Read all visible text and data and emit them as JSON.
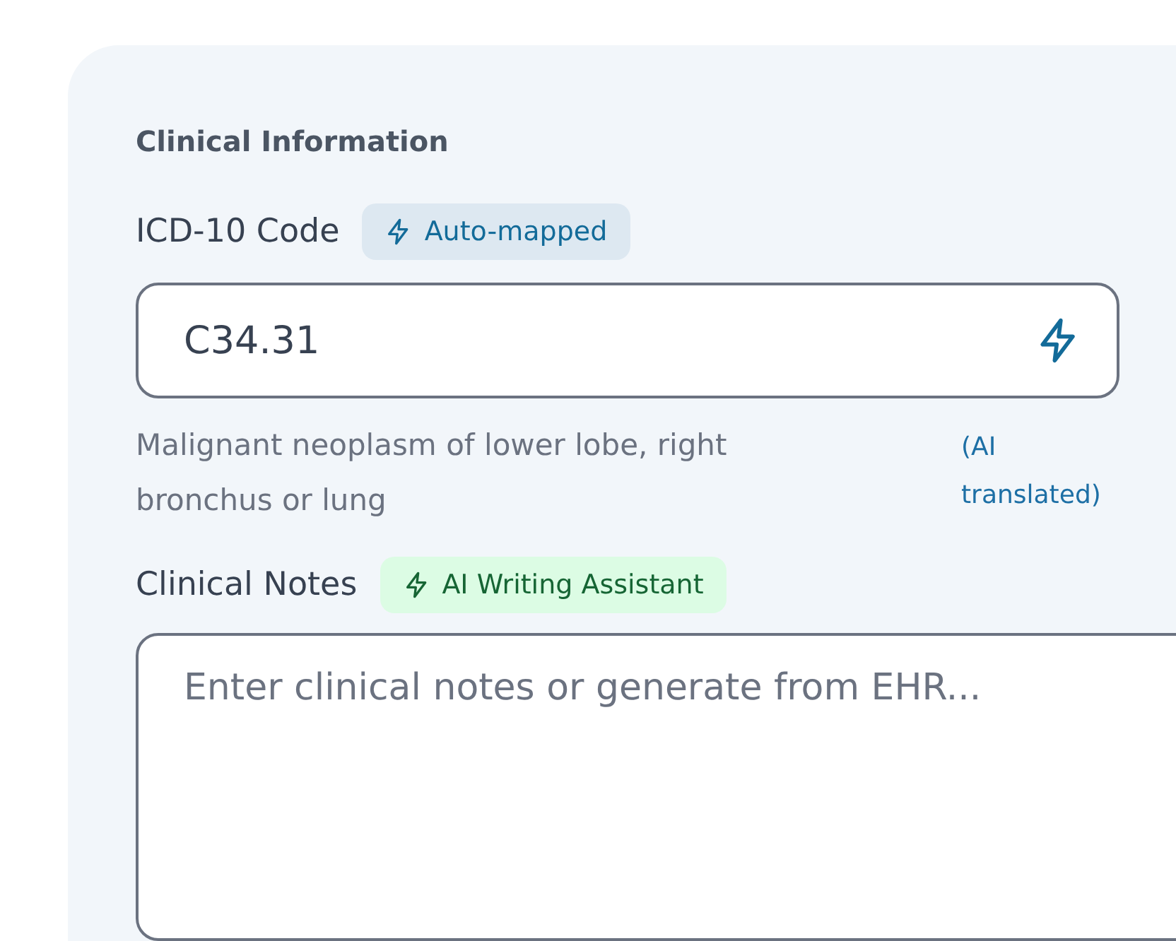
{
  "section_title": "Clinical Information",
  "icd_field": {
    "label": "ICD-10 Code",
    "badge": {
      "text": "Auto-mapped",
      "kind": "info"
    },
    "value": "C34.31",
    "description": "Malignant neoplasm of lower lobe, right bronchus or lung",
    "note": "(AI translated)"
  },
  "notes_field": {
    "label": "Clinical Notes",
    "badge": {
      "text": "AI Writing Assistant",
      "kind": "success"
    },
    "placeholder": "Enter clinical notes or generate from EHR..."
  }
}
